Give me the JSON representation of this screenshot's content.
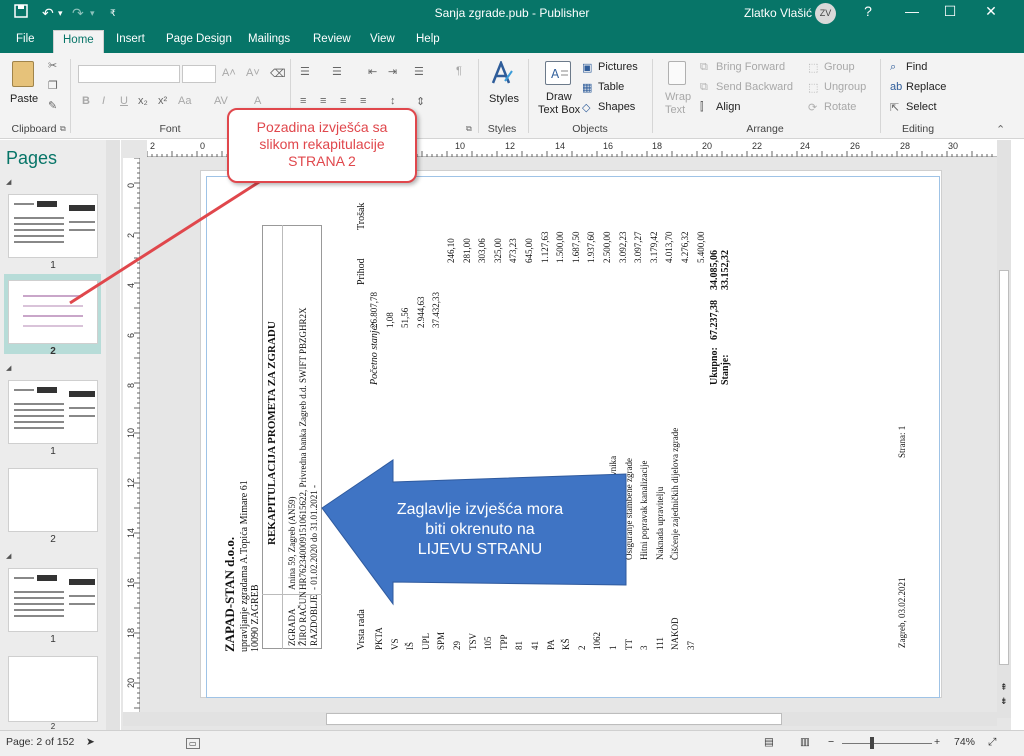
{
  "window": {
    "title": "Sanja zgrade.pub - Publisher",
    "user_name": "Zlatko Vlašić",
    "user_initials": "ZV",
    "help": "?"
  },
  "menu_tabs": [
    "File",
    "Home",
    "Insert",
    "Page Design",
    "Mailings",
    "Review",
    "View",
    "Help"
  ],
  "active_tab": "Home",
  "ribbon": {
    "clipboard": {
      "paste": "Paste",
      "label": "Clipboard"
    },
    "font": {
      "bold": "B",
      "italic": "I",
      "underline": "U",
      "label": "Font",
      "grow": "A˄",
      "shrink": "A˅",
      "case": "Aa",
      "spacing": "AV",
      "color": "A"
    },
    "paragraph": {
      "label": "Paragraph",
      "pilcrow": "¶"
    },
    "styles": {
      "styles": "Styles",
      "label": "Styles"
    },
    "objects": {
      "draw_text_box_1": "Draw",
      "draw_text_box_2": "Text Box",
      "pictures": "Pictures",
      "table": "Table",
      "shapes": "Shapes",
      "label": "Objects"
    },
    "arrange": {
      "wrap_text_1": "Wrap",
      "wrap_text_2": "Text",
      "bring_forward": "Bring Forward",
      "send_backward": "Send Backward",
      "align": "Align",
      "group": "Group",
      "ungroup": "Ungroup",
      "rotate": "Rotate",
      "label": "Arrange"
    },
    "editing": {
      "find": "Find",
      "replace": "Replace",
      "select": "Select",
      "label": "Editing"
    }
  },
  "pages_pane": {
    "title": "Pages",
    "page_labels": [
      "1",
      "2",
      "1",
      "2",
      "1",
      "2"
    ]
  },
  "rulers": {
    "horizontal": [
      "2",
      "0",
      "2",
      "4",
      "6",
      "8",
      "10",
      "12",
      "14",
      "16",
      "18",
      "20",
      "22",
      "24",
      "26",
      "28",
      "30"
    ],
    "vertical": [
      "0",
      "2",
      "4",
      "6",
      "8",
      "10",
      "12",
      "14",
      "16",
      "18",
      "20"
    ]
  },
  "report": {
    "company": "ZAPAD-STAN d.o.o.",
    "company_sub": "upravljanje zgradama A.Topića Mimare 61",
    "company_city": "10090 ZAGREB",
    "heading": "REKAPITULACIJA PROMETA ZA ZGRADU",
    "info_labels": [
      "ZGRADA",
      "ŽIRO RAČUN",
      "RAZDOBLJE"
    ],
    "info_values": [
      "Anina 59, Zagreb (AN59)",
      "HR7623400091510615622, Privredna banka Zagreb d.d. SWIFT PBZGHR2X",
      "- 01.02.2020 do 31.01.2021 -"
    ],
    "col_vrsta": "Vrsta rada",
    "col_prihod": "Prihod",
    "col_trosak": "Trošak",
    "pocetno": "Početno stanje:",
    "codes": [
      "PKTA",
      "VS",
      "IŠ",
      "UPL",
      "SPM",
      "29",
      "TSV",
      "105",
      "TPP",
      "81",
      "41",
      "PA",
      "KŠ",
      "2",
      "1062",
      "1",
      "TT",
      "3",
      "111",
      "NAKOD",
      "37"
    ],
    "descriptions": [
      "",
      "",
      "",
      "",
      "",
      "",
      "e",
      "",
      "šće",
      "",
      "a",
      "",
      "d",
      "",
      "ija el.energije",
      "Trošak telefona predstavnika",
      "Osiguranje stambene zgrade",
      "Hitni popravak kanalizacije",
      "Naknada upravitelju",
      "Čišćenje zajedničkih dijelova zgrade",
      ""
    ],
    "prihod": [
      "26.807,78",
      "1,08",
      "51,56",
      "2.944,63",
      "37.432,33"
    ],
    "trosak": [
      "246,10",
      "281,00",
      "303,06",
      "325,00",
      "473,23",
      "645,00",
      "1.127,63",
      "1.500,00",
      "1.687,50",
      "1.937,60",
      "2.500,00",
      "3.092,23",
      "3.097,27",
      "3.179,42",
      "4.013,70",
      "4.276,32",
      "5.400,00"
    ],
    "ukupno_label": "Ukupno:",
    "stanje_label": "Stanje:",
    "ukupno_prihod": "67.237,38",
    "ukupno_trosak": "34.085,06",
    "stanje_trosak": "33.152,32",
    "strana": "Strana: 1",
    "date": "Zagreb, 03.02.2021"
  },
  "callouts": {
    "top": [
      "Pozadina izvješća sa",
      "slikom rekapitulacije",
      "STRANA 2"
    ],
    "arrow": [
      "Zaglavlje izvješća mora",
      "biti okrenuto na",
      "LIJEVU STRANU"
    ]
  },
  "status": {
    "page": "Page: 2 of 152",
    "zoom": "74%",
    "minus": "−",
    "plus": "+"
  },
  "colors": {
    "accent": "#077568",
    "callout_red": "#e0474c",
    "arrow_blue": "#3f74c4"
  }
}
